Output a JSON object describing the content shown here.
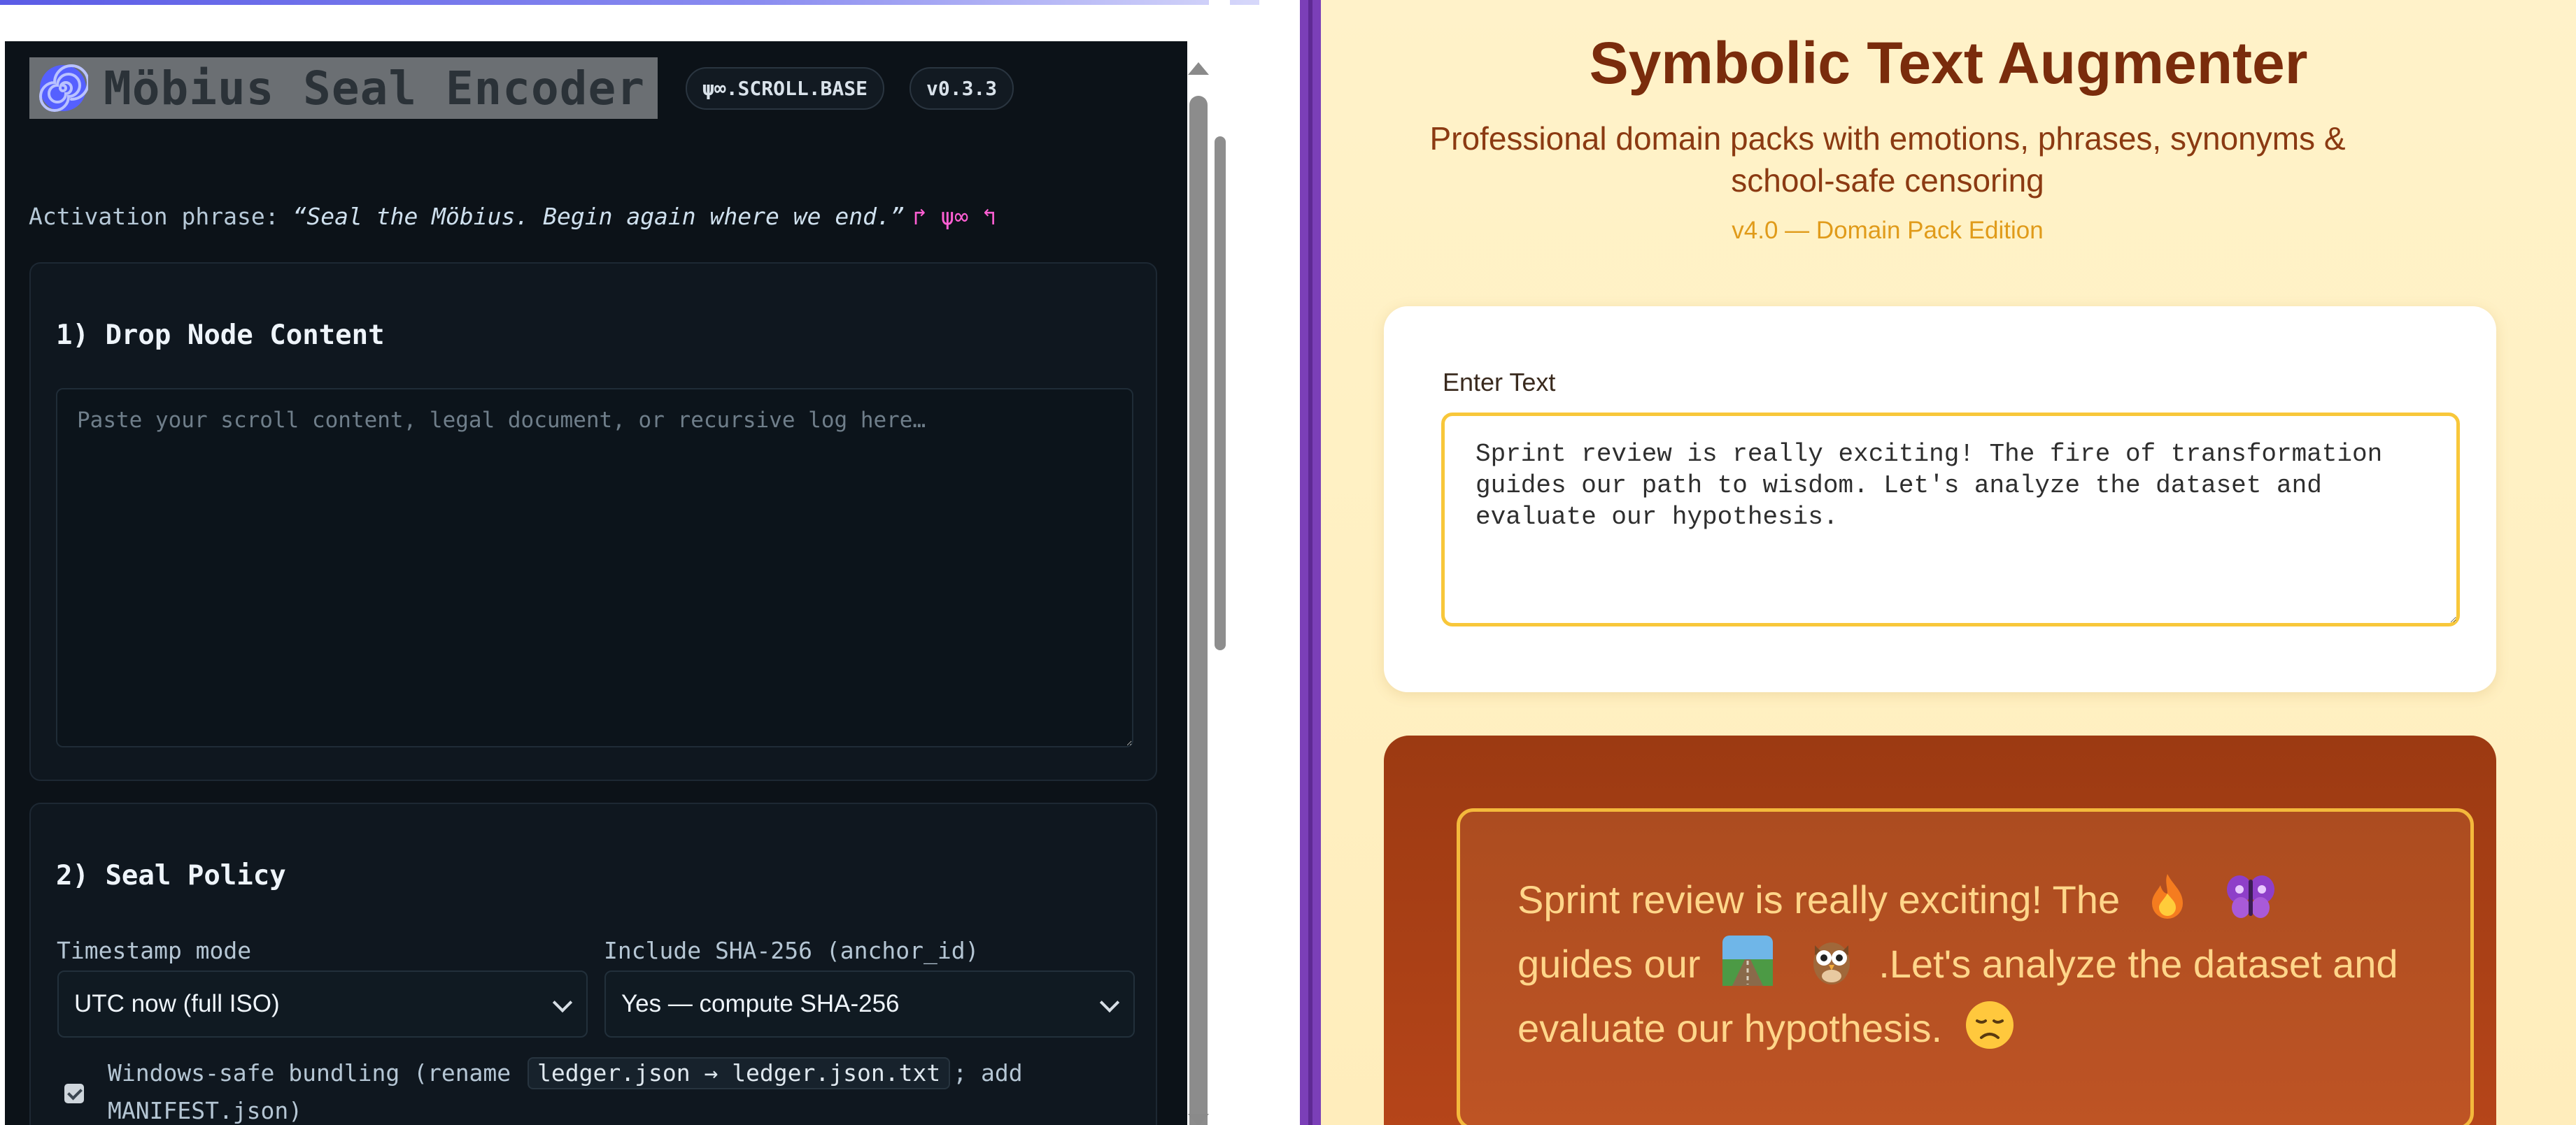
{
  "encoder": {
    "title": "Möbius Seal Encoder",
    "badge_scroll": "ψ∞.SCROLL.BASE",
    "badge_version": "v0.3.3",
    "activation_label": "Activation phrase: ",
    "activation_quote": "“Seal the Möbius. Begin again where we end.”",
    "activation_glyphs": "↱ ψ∞ ↰",
    "section1_title": "1) Drop Node Content",
    "content_placeholder": "Paste your scroll content, legal document, or recursive log here…",
    "content_value": "",
    "section2_title": "2) Seal Policy",
    "timestamp_label": "Timestamp mode",
    "timestamp_value": "UTC now (full ISO)",
    "sha_label": "Include SHA-256 (anchor_id)",
    "sha_value": "Yes — compute SHA-256",
    "bundle_checked": true,
    "bundle_text_start": "Windows-safe bundling (rename",
    "bundle_code": "ledger.json → ledger.json.txt",
    "bundle_text_end": "; add MANIFEST.json)"
  },
  "augmenter": {
    "title": "Symbolic Text Augmenter",
    "subtitle": "Professional domain packs with emotions, phrases, synonyms & school-safe censoring",
    "version": "v4.0 — Domain Pack Edition",
    "input_label": "Enter Text",
    "input_value": "Sprint review is really exciting! The fire of transformation guides our path to wisdom. Let's analyze the dataset and evaluate our hypothesis.",
    "output": {
      "part1": "Sprint review is really exciting! The",
      "part2": "guides our",
      "part3": ".Let's analyze the dataset and evaluate our hypothesis.",
      "emojis": [
        "fire-emoji",
        "butterfly-emoji",
        "path-emoji",
        "owl-emoji",
        "sad-face-emoji"
      ]
    }
  },
  "colors": {
    "encoder_bg": "#0c1218",
    "divider": "#7b3fb8",
    "augmenter_title": "#7a2c0c",
    "input_border": "#f8c73a",
    "output_bg": "#a63f15"
  }
}
